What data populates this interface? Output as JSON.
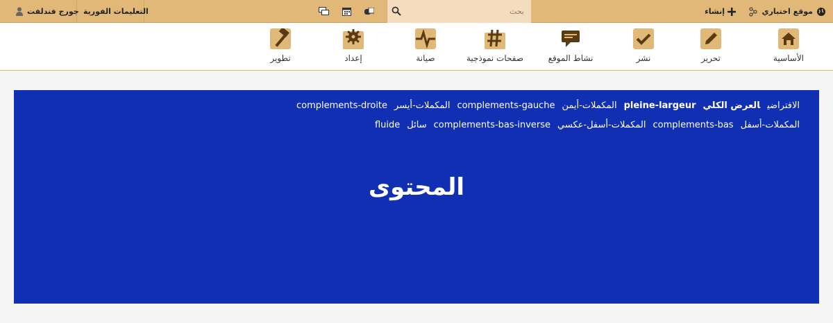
{
  "topbar": {
    "site_name": "موقع اختباري",
    "create_label": "إنشاء",
    "search_placeholder": "بحث",
    "quick_help": "التعليمات الفورية",
    "user_name": "جورج فندلفت"
  },
  "nav": {
    "items": [
      {
        "label": "الأساسية",
        "icon": "home-icon"
      },
      {
        "label": "تحرير",
        "icon": "pencil-icon"
      },
      {
        "label": "نشر",
        "icon": "checkmark-icon"
      },
      {
        "label": "نشاط الموقع",
        "icon": "speech-bubble-icon"
      },
      {
        "label": "صفحات نموذجية",
        "icon": "hash-icon"
      },
      {
        "label": "صيانة",
        "icon": "pulse-icon"
      },
      {
        "label": "إعداد",
        "icon": "gear-icon"
      },
      {
        "label": "تطوير",
        "icon": "hammer-icon"
      }
    ]
  },
  "panel": {
    "line1": {
      "default": "الافتراضي",
      "full_width": "العرض الكلي",
      "pleine": "pleine-largeur",
      "right_complements": "المكملات-أيمن",
      "gauche": "complements-gauche",
      "left_complements": "المكملات-أيسر",
      "droite": "complements-droite"
    },
    "line2": {
      "bottom_complements": "المكملات-أسفل",
      "bas": "complements-bas",
      "bottom_reverse": "المكملات-أسفل-عكسي",
      "bas_inverse": "complements-bas-inverse",
      "fluid": "سائل",
      "fluide": "fluide"
    },
    "title": "المحتوى"
  },
  "colors": {
    "topbar": "#e1b877",
    "panel": "#112fb2",
    "icon_box": "#e1b877",
    "icon_dark": "#5a3a12"
  }
}
